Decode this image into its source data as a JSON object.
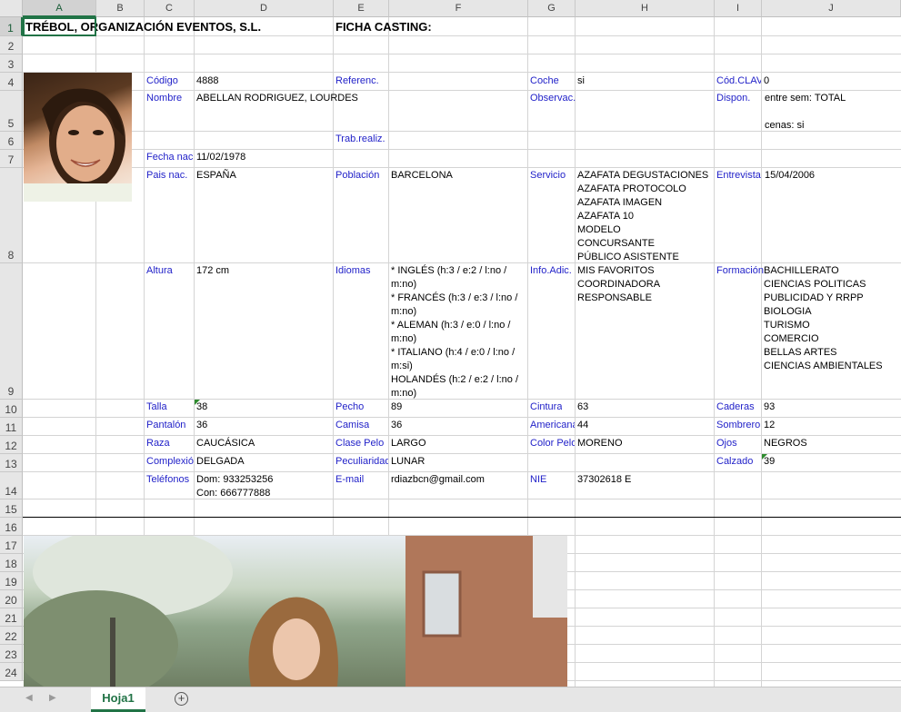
{
  "columns": [
    "A",
    "B",
    "C",
    "D",
    "E",
    "F",
    "G",
    "H",
    "I",
    "J"
  ],
  "rows": [
    "1",
    "2",
    "3",
    "4",
    "5",
    "6",
    "7",
    "8",
    "9",
    "10",
    "11",
    "12",
    "13",
    "14",
    "15",
    "16",
    "17",
    "18",
    "19",
    "20",
    "21",
    "22",
    "23",
    "24"
  ],
  "header": {
    "company": "TRÉBOL, ORGANIZACIÓN EVENTOS, S.L.",
    "sheet_title": "FICHA CASTING:"
  },
  "fields": {
    "codigo": {
      "label": "Código",
      "value": "4888"
    },
    "referenc": {
      "label": "Referenc.",
      "value": ""
    },
    "coche": {
      "label": "Coche",
      "value": "si"
    },
    "cod_clave": {
      "label": "Cód.CLAV",
      "value": "0"
    },
    "nombre": {
      "label": "Nombre",
      "value": "ABELLAN RODRIGUEZ, LOURDES"
    },
    "observac": {
      "label": "Observac.",
      "value": ""
    },
    "dispon": {
      "label": "Dispon.",
      "value": "entre sem: TOTAL\n\ncenas: si"
    },
    "trab_realiz": {
      "label": "Trab.realiz.",
      "value": ""
    },
    "fecha_nac": {
      "label": "Fecha nac",
      "value": "11/02/1978"
    },
    "pais_nac": {
      "label": "Pais nac.",
      "value": "ESPAÑA"
    },
    "poblacion": {
      "label": "Población",
      "value": "BARCELONA"
    },
    "servicio": {
      "label": "Servicio",
      "value": "AZAFATA DEGUSTACIONES\nAZAFATA PROTOCOLO\nAZAFATA IMAGEN\nAZAFATA 10\nMODELO\nCONCURSANTE\nPÚBLICO ASISTENTE"
    },
    "entrevista": {
      "label": "Entrevista",
      "value": "15/04/2006"
    },
    "altura": {
      "label": "Altura",
      "value": "172 cm"
    },
    "idiomas": {
      "label": "Idiomas",
      "value": "* INGLÉS (h:3 / e:2 / l:no /\nm:no)\n* FRANCÉS (h:3 / e:3 / l:no /\nm:no)\n* ALEMAN (h:3 / e:0 / l:no /\nm:no)\n* ITALIANO (h:4 / e:0 / l:no /\nm:si)\nHOLANDÉS (h:2 / e:2 / l:no /\nm:no)"
    },
    "info_adic": {
      "label": "Info.Adic.",
      "value": "MIS FAVORITOS\nCOORDINADORA\nRESPONSABLE"
    },
    "formacion": {
      "label": "Formación",
      "value": "BACHILLERATO\nCIENCIAS POLITICAS\nPUBLICIDAD Y RRPP\nBIOLOGIA\nTURISMO\nCOMERCIO\nBELLAS ARTES\nCIENCIAS AMBIENTALES"
    },
    "talla": {
      "label": "Talla",
      "value": "38"
    },
    "pecho": {
      "label": "Pecho",
      "value": "89"
    },
    "cintura": {
      "label": "Cintura",
      "value": "63"
    },
    "caderas": {
      "label": "Caderas",
      "value": "93"
    },
    "pantalon": {
      "label": "Pantalón",
      "value": "36"
    },
    "camisa": {
      "label": "Camisa",
      "value": "36"
    },
    "americana": {
      "label": "Americana",
      "value": "44"
    },
    "sombrero": {
      "label": "Sombrero",
      "value": "12"
    },
    "raza": {
      "label": "Raza",
      "value": "CAUCÁSICA"
    },
    "clase_pelo": {
      "label": "Clase Pelo",
      "value": "LARGO"
    },
    "color_pelo": {
      "label": "Color Pelo",
      "value": "MORENO"
    },
    "ojos": {
      "label": "Ojos",
      "value": "NEGROS"
    },
    "complexion": {
      "label": "Complexión",
      "value": "DELGADA"
    },
    "peculiaridad": {
      "label": "Peculiaridad",
      "value": "LUNAR"
    },
    "calzado": {
      "label": "Calzado",
      "value": "39"
    },
    "telefonos": {
      "label": "Teléfonos",
      "value": "Dom: 933253256\nCon: 666777888"
    },
    "email": {
      "label": "E-mail",
      "value": "rdiazbcn@gmail.com"
    },
    "nie": {
      "label": "NIE",
      "value": "37302618 E"
    }
  },
  "sheet_tabs": [
    {
      "label": "Hoja1",
      "active": true
    }
  ],
  "colors": {
    "label_blue": "#1f1fc8",
    "excel_green": "#217346"
  }
}
